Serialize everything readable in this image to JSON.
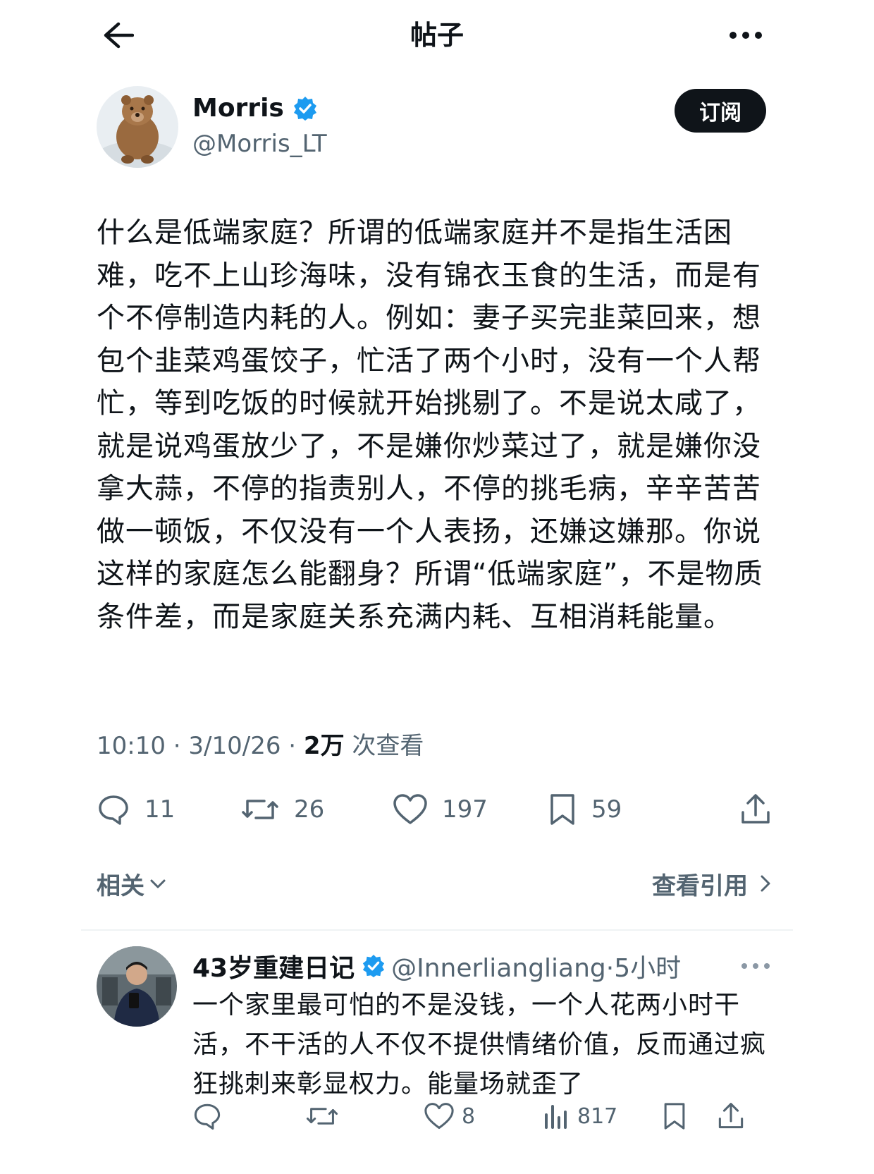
{
  "header": {
    "title": "帖子"
  },
  "post": {
    "author_name": "Morris",
    "author_handle": "@Morris_LT",
    "subscribe_label": "订阅",
    "text": "什么是低端家庭？所谓的低端家庭并不是指生活困难，吃不上山珍海味，没有锦衣玉食的生活，而是有个不停制造内耗的人。例如：妻子买完韭菜回来，想包个韭菜鸡蛋饺子，忙活了两个小时，没有一个人帮忙，等到吃饭的时候就开始挑剔了。不是说太咸了，就是说鸡蛋放少了，不是嫌你炒菜过了，就是嫌你没拿大蒜，不停的指责别人，不停的挑毛病，辛辛苦苦做一顿饭，不仅没有一个人表扬，还嫌这嫌那。你说这样的家庭怎么能翻身？所谓“低端家庭”，不是物质条件差，而是家庭关系充满内耗、互相消耗能量。",
    "time": "10:10 · 3/10/26 · ",
    "views_count": "2万",
    "views_label": " 次查看",
    "stats": {
      "replies": "11",
      "reposts": "26",
      "likes": "197",
      "bookmarks": "59"
    }
  },
  "related": {
    "label": "相关",
    "quotes_label": "查看引用"
  },
  "reply": {
    "author_name": "43岁重建日记",
    "author_handle": "@Innerliangliang·5小时",
    "text": "一个家里最可怕的不是没钱，一个人花两小时干活，不干活的人不仅不提供情绪价值，反而通过疯狂挑刺来彰显权力。能量场就歪了",
    "stats": {
      "likes": "8",
      "views": "817"
    }
  },
  "colors": {
    "verified": "#1d9bf0",
    "text": "#0f1419",
    "muted": "#536471"
  }
}
